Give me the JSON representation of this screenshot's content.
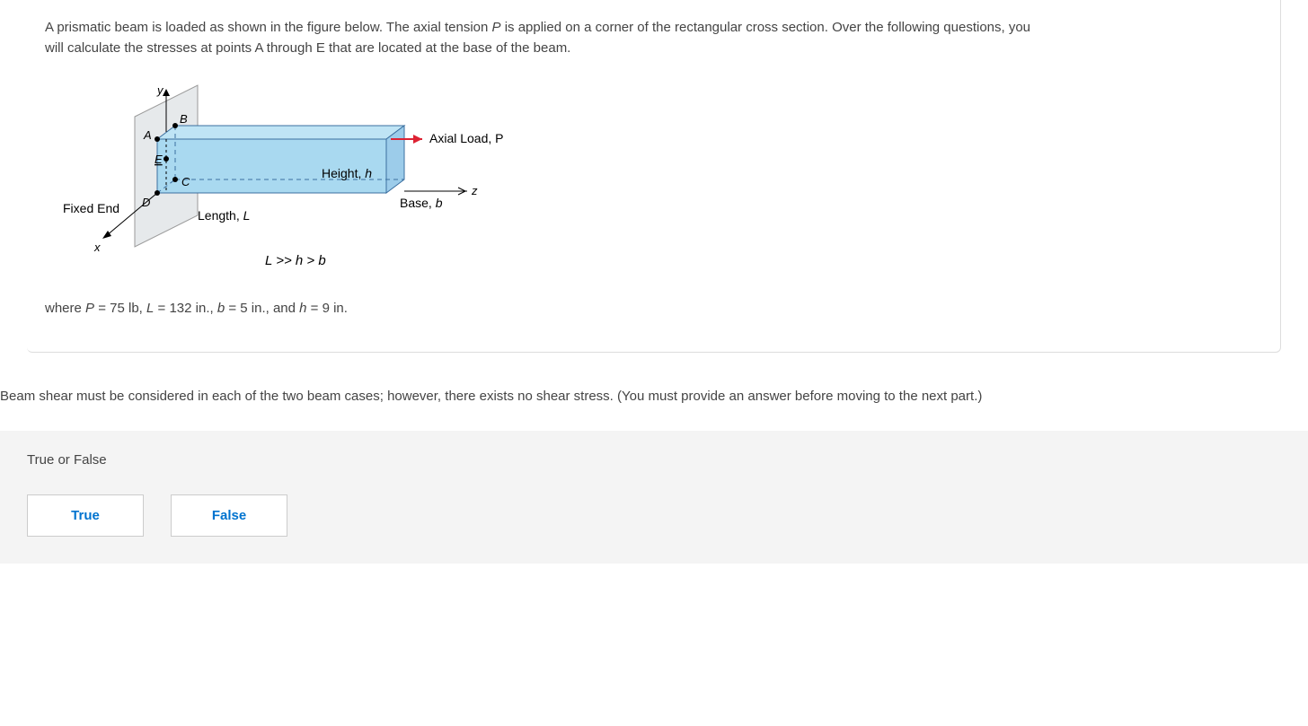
{
  "prompt": {
    "line1": "A prismatic beam is loaded as shown in the figure below. The axial tension ",
    "p_var": "P",
    "line1b": " is applied on a corner of the rectangular cross section. Over the following questions, you will calculate the stresses at points A through E that are located at the base of the beam."
  },
  "figure": {
    "labels": {
      "y": "y",
      "x": "x",
      "z": "z",
      "A": "A",
      "B": "B",
      "C": "C",
      "D": "D",
      "E": "E",
      "fixed_end": "Fixed End",
      "length": "Length, L",
      "height": "Height, h",
      "base": "Base, b",
      "axial_load": "Axial Load, P",
      "relation": "L >> h > b"
    }
  },
  "where": {
    "pre": "where ",
    "P_lhs": "P",
    "P_eq": " = 75 lb, ",
    "L_lhs": "L",
    "L_eq": " = 132 in., ",
    "b_lhs": "b",
    "b_eq": " = 5 in., and ",
    "h_lhs": "h",
    "h_eq": " = 9 in."
  },
  "instruction": "Beam shear must be considered in each of the two beam cases; however, there exists no shear stress. (You must provide an answer before moving to the next part.)",
  "answer": {
    "label": "True or False",
    "true_btn": "True",
    "false_btn": "False"
  },
  "chart_data": {
    "type": "table",
    "title": "Given values",
    "rows": [
      {
        "variable": "P",
        "value": 75,
        "unit": "lb"
      },
      {
        "variable": "L",
        "value": 132,
        "unit": "in."
      },
      {
        "variable": "b",
        "value": 5,
        "unit": "in."
      },
      {
        "variable": "h",
        "value": 9,
        "unit": "in."
      }
    ],
    "geometry_relation": "L >> h > b"
  }
}
